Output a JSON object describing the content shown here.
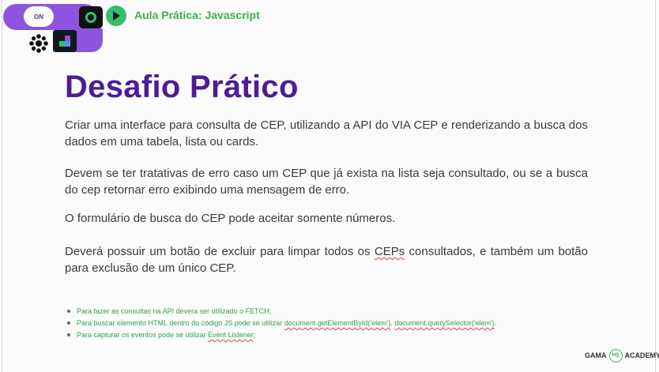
{
  "header": {
    "title": "Aula Prática: Javascript",
    "logo_badge": "ON",
    "icons": [
      "toggle-icon",
      "ring-icon",
      "play-icon",
      "gear-icon",
      "tile-icon"
    ]
  },
  "slide": {
    "title": "Desafio Prático",
    "paragraphs": [
      {
        "text": "Criar uma interface para consulta de CEP, utilizando a API do VIA CEP e renderizando a busca dos dados em uma tabela, lista ou cards."
      },
      {
        "text": "Devem se ter tratativas de erro caso um CEP que já exista na lista seja consultado, ou se a busca do cep retornar erro exibindo uma mensagem de erro."
      },
      {
        "text": "O formulário de busca do CEP pode aceitar somente números."
      },
      {
        "before": "Deverá possuir um botão de excluir para limpar todos os ",
        "marked": "CEPs",
        "after": " consultados, e também um botão para exclusão de um único CEP."
      }
    ],
    "bullets": [
      {
        "text": "Para fazer as consultas na API devera ser utilizado o FETCH;"
      },
      {
        "before": "Para buscar elemento HTML dentro do código JS pode se utilizar ",
        "code1": "document.getElementById('elem')",
        "mid": ", ",
        "code2": "document.querySelector('elem')",
        "after": "."
      },
      {
        "before": "Para capturar os eventos pode se utilizar ",
        "code": "Event Listener",
        "after": ";"
      }
    ]
  },
  "footer": {
    "brand_left": "GAMA",
    "badge": "HQ",
    "brand_right": "ACADEMY"
  },
  "colors": {
    "title_purple": "#4f1c98",
    "accent_purple": "#8d54e0",
    "brand_green": "#3fae4e",
    "text_gray": "#3a3a3a"
  }
}
